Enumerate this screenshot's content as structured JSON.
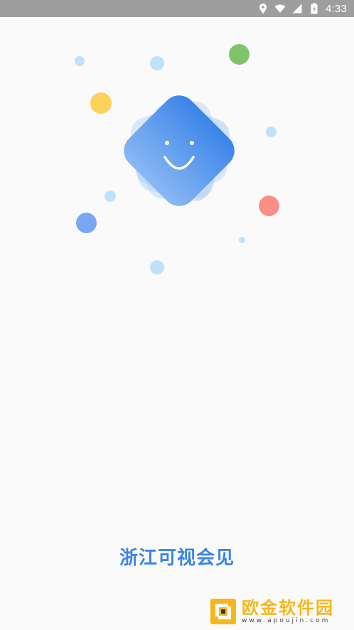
{
  "status_bar": {
    "time": "4:33",
    "icons": [
      "location-icon",
      "wifi-icon",
      "signal-icon",
      "battery-icon"
    ]
  },
  "splash": {
    "app_title": "浙江可视会见",
    "mascot_icon": "smiley-face-icon",
    "colors": {
      "primary_blue": "#3b84e8",
      "dot_light_blue": "#bfe1fb",
      "dot_green": "#7fc46a",
      "dot_yellow": "#fdd25b",
      "dot_blue": "#7aa7f4",
      "dot_red": "#fb8f86"
    }
  },
  "watermark": {
    "title": "欧金软件园",
    "url": "www.apoujin.com"
  }
}
